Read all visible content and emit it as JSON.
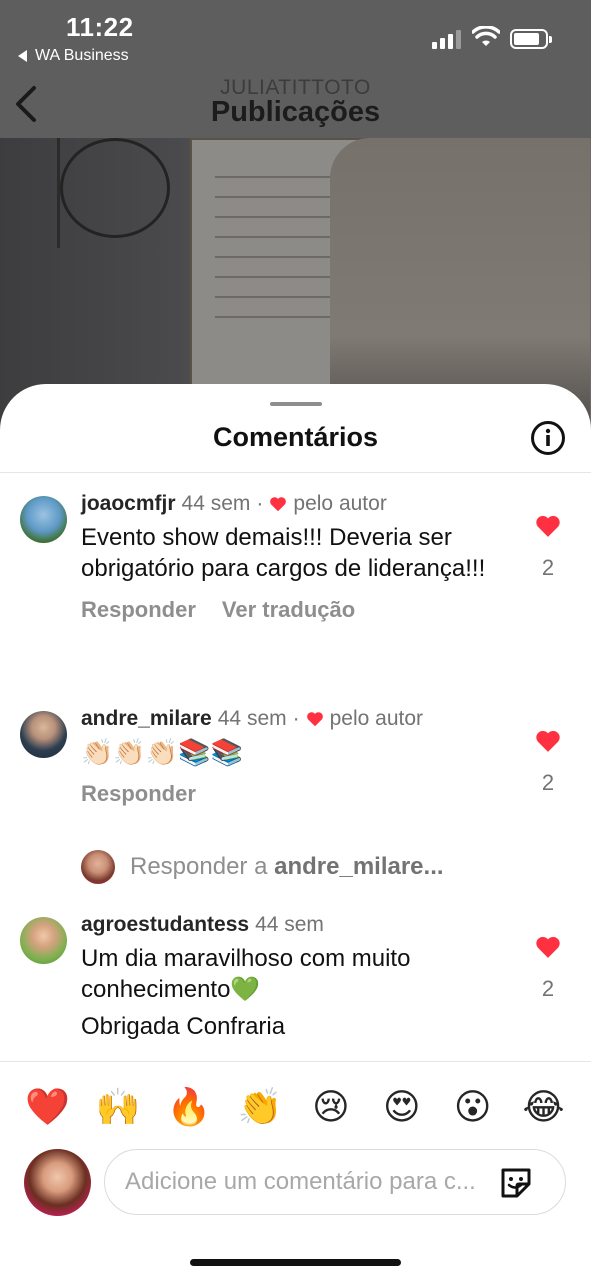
{
  "status_bar": {
    "time": "11:22",
    "back_app": "WA Business"
  },
  "nav": {
    "username": "JULIATITTOTO",
    "title": "Publicações"
  },
  "sheet": {
    "title": "Comentários"
  },
  "comments": [
    {
      "username": "joaocmfjr",
      "age": "44 sem",
      "liked_by_author": "pelo autor",
      "text": "Evento show demais!!! Deveria ser obrigatório para cargos de liderança!!!",
      "actions": [
        "Responder",
        "Ver tradução"
      ],
      "likes": "2"
    },
    {
      "username": "andre_milare",
      "age": "44 sem",
      "liked_by_author": "pelo autor",
      "text": "👏🏻👏🏻👏🏻📚📚",
      "actions": [
        "Responder"
      ],
      "likes": "2"
    },
    {
      "username": "agroestudantess",
      "age": "44 sem",
      "text_line1": "Um dia maravilhoso com muito conhecimento💚",
      "text_line2": "Obrigada Confraria",
      "likes": "2"
    }
  ],
  "reply_to": {
    "prefix": "Responder a",
    "username": "andre_milare..."
  },
  "emoji_bar": [
    "❤️",
    "🙌",
    "🔥",
    "👏",
    "😢",
    "😍",
    "😮",
    "😂"
  ],
  "composer": {
    "placeholder": "Adicione um comentário para c..."
  },
  "colors": {
    "like_red": "#ff3040",
    "header_gray": "#5e5e5e",
    "muted_text": "#8e8e8e"
  }
}
